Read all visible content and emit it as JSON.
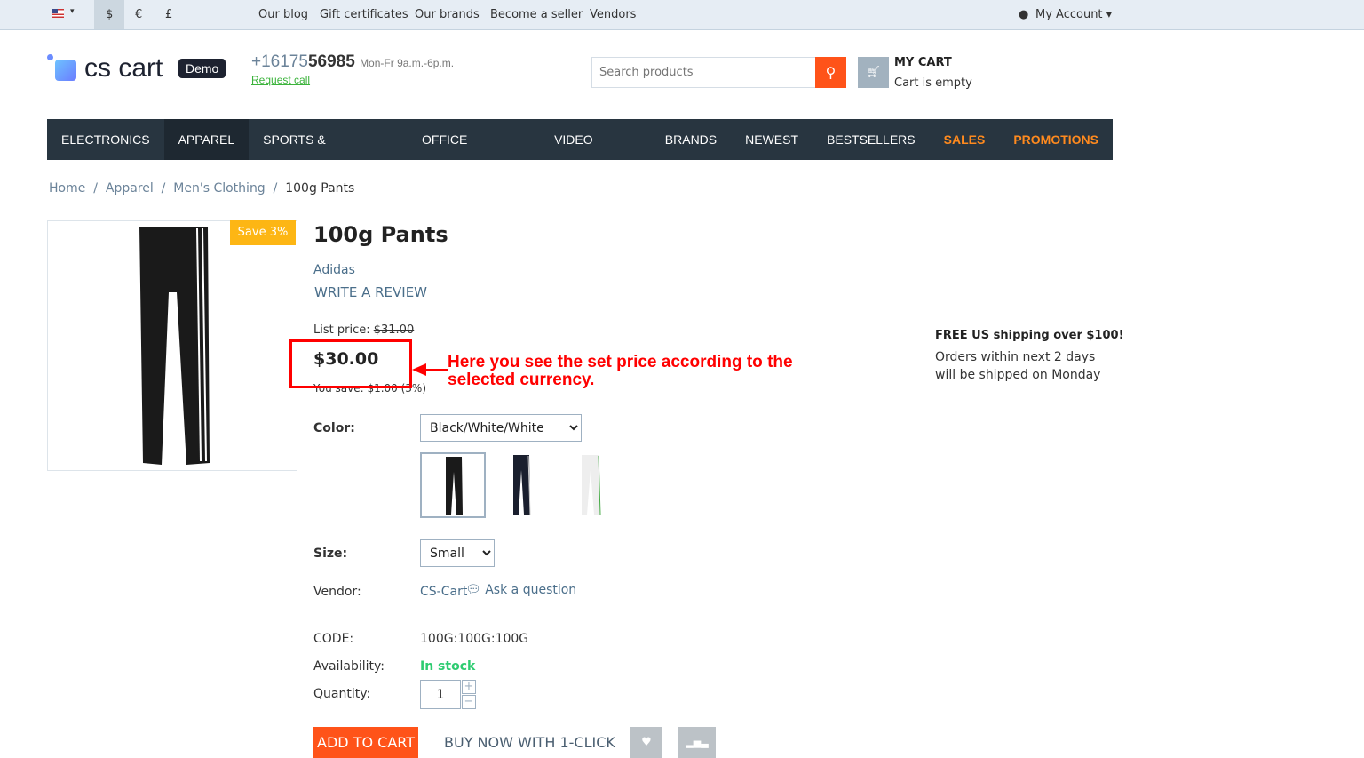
{
  "topbar": {
    "language_flag": "us-flag-icon",
    "currencies": [
      "$",
      "€",
      "£"
    ],
    "links": [
      "Our blog",
      "Gift certificates",
      "Our brands",
      "Become a seller",
      "Vendors"
    ],
    "account": "My Account"
  },
  "header": {
    "logo": "cs cart",
    "demo_badge": "Demo",
    "phone_prefix": "+16175",
    "phone_suffix": "56985",
    "hours": "Mon-Fr 9a.m.-6p.m.",
    "request_call": "Request call",
    "search_placeholder": "Search products",
    "cart_title": "MY CART",
    "cart_status": "Cart is empty"
  },
  "nav": [
    "ELECTRONICS",
    "APPAREL",
    "SPORTS & OUTDOORS",
    "OFFICE SUPPLIES",
    "VIDEO GAMES",
    "BRANDS",
    "NEWEST",
    "BESTSELLERS",
    "SALES",
    "PROMOTIONS"
  ],
  "breadcrumb": [
    "Home",
    "Apparel",
    "Men's Clothing",
    "100g Pants"
  ],
  "product": {
    "save_badge": "Save 3%",
    "title": "100g Pants",
    "brand": "Adidas",
    "write_review": "WRITE A REVIEW",
    "list_price_label": "List price:",
    "list_price": "$31.00",
    "price": "$30.00",
    "you_save": "You save: $1.00 (3%)",
    "color_label": "Color:",
    "color_value": "Black/White/White",
    "size_label": "Size:",
    "size_value": "Small",
    "vendor_label": "Vendor:",
    "vendor": "CS-Cart",
    "ask_question": "Ask a question",
    "code_label": "CODE:",
    "code": "100G:100G:100G",
    "availability_label": "Availability:",
    "availability": "In stock",
    "quantity_label": "Quantity:",
    "quantity": "1",
    "add_to_cart": "ADD TO CART",
    "buy_now": "BUY NOW WITH 1-CLICK"
  },
  "shipping": {
    "title": "FREE US shipping over $100!",
    "text": "Orders within next 2 days will be shipped on Monday"
  },
  "annotation": {
    "text_line1": "Here you see the set price according to the",
    "text_line2": "selected currency."
  },
  "colors": {
    "accent": "#ff5319",
    "nav": "#283540",
    "in_stock": "#2ecc71",
    "annotation": "#ff0000"
  }
}
